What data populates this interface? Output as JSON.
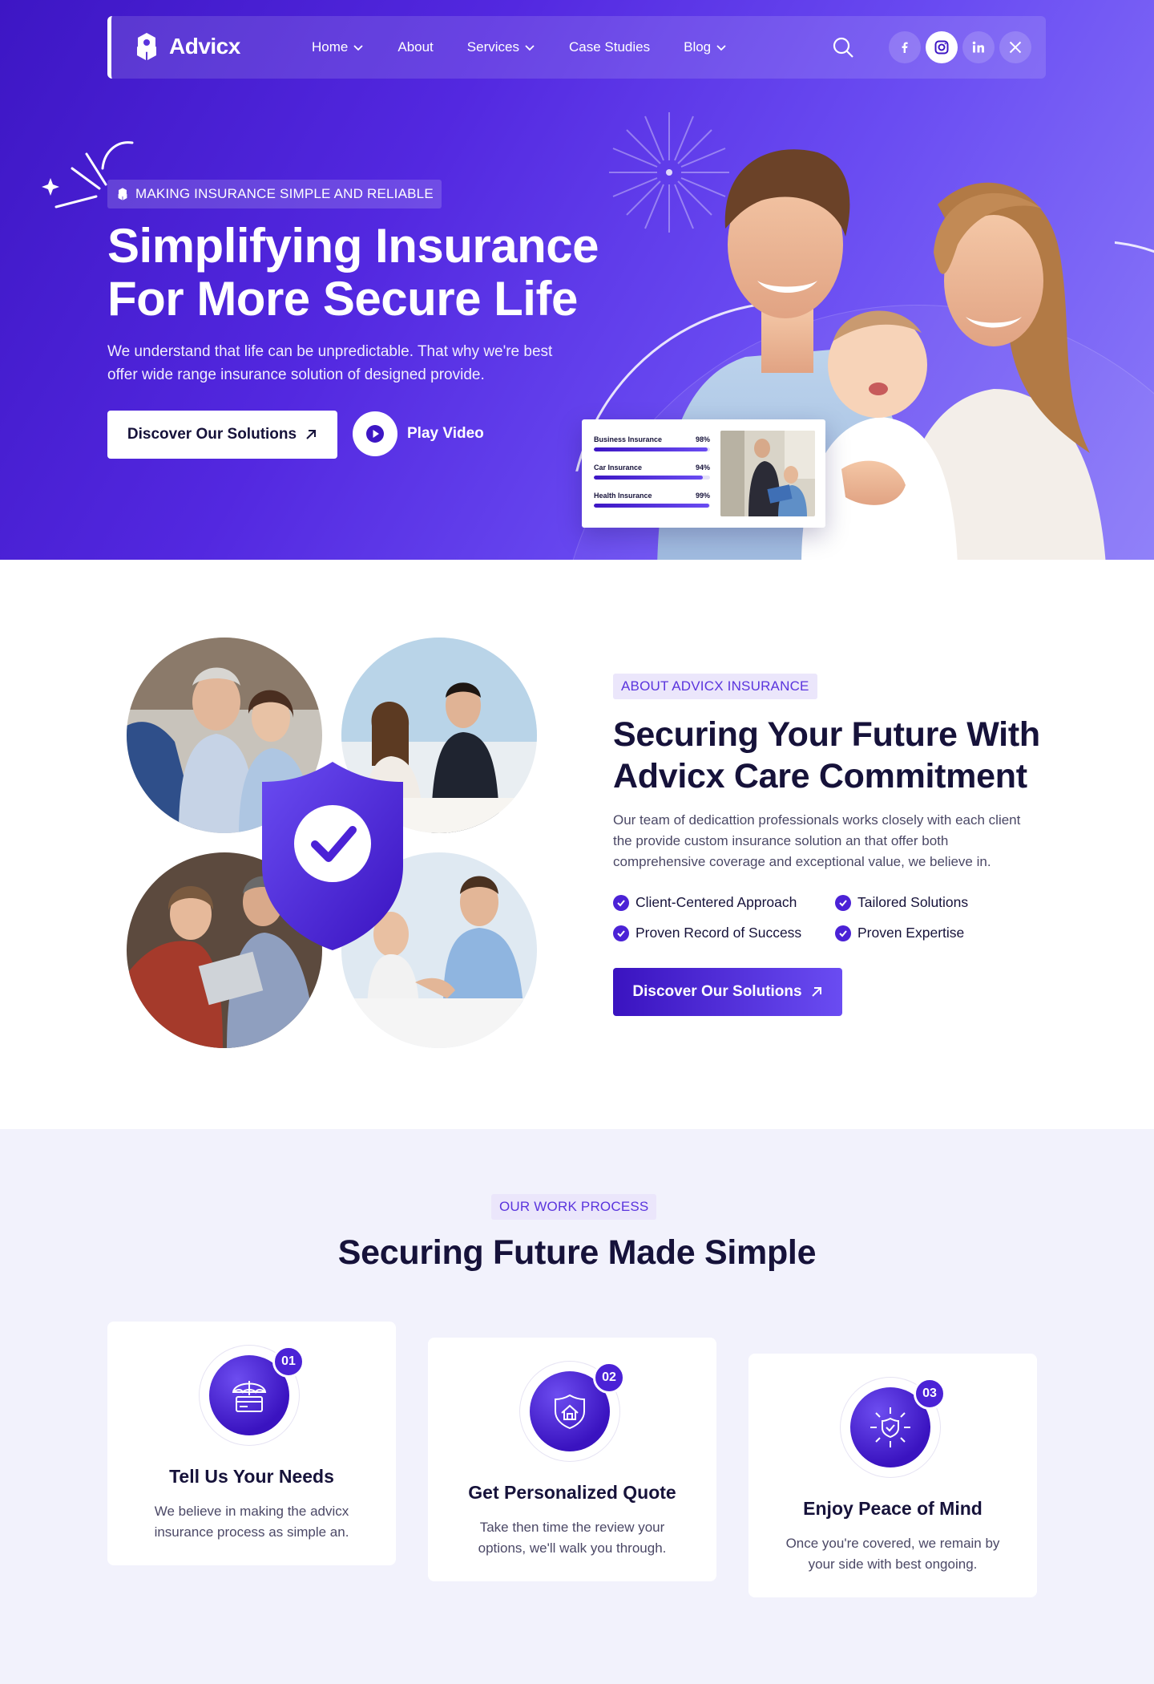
{
  "brand": {
    "name": "Advicx",
    "accent": "#4b22d6",
    "hero_gradient_start": "#3d16c4",
    "hero_gradient_end": "#8b7bf9"
  },
  "nav": {
    "items": [
      {
        "label": "Home",
        "dropdown": true
      },
      {
        "label": "About",
        "dropdown": false
      },
      {
        "label": "Services",
        "dropdown": true
      },
      {
        "label": "Case Studies",
        "dropdown": false
      },
      {
        "label": "Blog",
        "dropdown": true
      }
    ],
    "search_icon": "search-icon",
    "social": [
      {
        "label": "f",
        "icon": "facebook-icon"
      },
      {
        "label": "instagram",
        "icon": "instagram-icon"
      },
      {
        "label": "in",
        "icon": "linkedin-icon"
      },
      {
        "label": "X",
        "icon": "x-icon"
      }
    ]
  },
  "hero": {
    "badge": "MAKING INSURANCE SIMPLE AND RELIABLE",
    "title_line1": "Simplifying Insurance",
    "title_line2": "For More Secure Life",
    "description": "We understand that life can be unpredictable. That why we're best offer wide range insurance solution of designed provide.",
    "primary_button": "Discover Our Solutions",
    "video_button": "Play Video",
    "stats": [
      {
        "label": "Business Insurance",
        "value": "98%",
        "percent": 98
      },
      {
        "label": "Car Insurance",
        "value": "94%",
        "percent": 94
      },
      {
        "label": "Health Insurance",
        "value": "99%",
        "percent": 99
      }
    ]
  },
  "about": {
    "tag": "ABOUT ADVICX INSURANCE",
    "title_line1": "Securing Your Future With",
    "title_line2": "Advicx Care Commitment",
    "description": "Our team of dedicattion professionals works closely with each client the provide custom insurance solution an that offer both comprehensive coverage and exceptional value, we believe in.",
    "features": [
      "Client-Centered Approach",
      "Tailored Solutions",
      "Proven Record of Success",
      "Proven Expertise"
    ],
    "button": "Discover Our Solutions"
  },
  "process": {
    "tag": "OUR WORK PROCESS",
    "title": "Securing Future Made Simple",
    "steps": [
      {
        "number": "01",
        "title": "Tell Us Your Needs",
        "description": "We believe in making the advicx insurance process as simple an.",
        "icon": "umbrella-card-icon"
      },
      {
        "number": "02",
        "title": "Get Personalized Quote",
        "description": "Take then time the review your options, we'll walk you through.",
        "icon": "house-shield-icon"
      },
      {
        "number": "03",
        "title": "Enjoy Peace of Mind",
        "description": "Once you're covered, we remain by your side with best ongoing.",
        "icon": "shield-arrows-icon"
      }
    ]
  }
}
